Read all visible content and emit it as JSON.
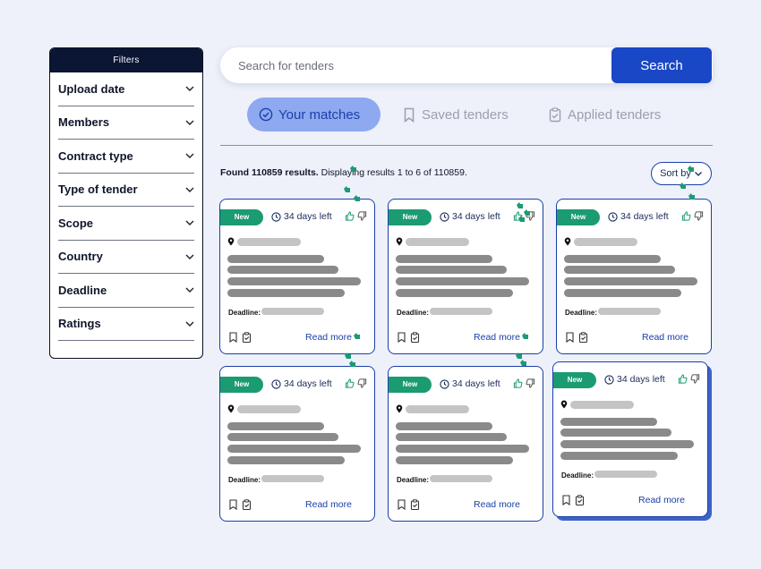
{
  "sidebar": {
    "title": "Filters",
    "items": [
      {
        "label": "Upload date"
      },
      {
        "label": "Members"
      },
      {
        "label": "Contract type"
      },
      {
        "label": "Type of tender"
      },
      {
        "label": "Scope"
      },
      {
        "label": "Country"
      },
      {
        "label": "Deadline"
      },
      {
        "label": "Ratings"
      }
    ]
  },
  "search": {
    "placeholder": "Search for tenders",
    "value": "",
    "button_label": "Search"
  },
  "tabs": [
    {
      "label": "Your matches",
      "active": true,
      "icon": "check-badge-icon"
    },
    {
      "label": "Saved tenders",
      "active": false,
      "icon": "bookmark-icon"
    },
    {
      "label": "Applied tenders",
      "active": false,
      "icon": "clipboard-check-icon"
    }
  ],
  "results": {
    "found_text": "Found 110859 results.",
    "display_text": " Displaying results 1 to 6 of 110859."
  },
  "sort": {
    "label": "Sort by"
  },
  "cards": [
    {
      "badge": "New",
      "days": "34 days left",
      "deadline_label": "Deadline:",
      "read_more": "Read more"
    },
    {
      "badge": "New",
      "days": "34 days left",
      "deadline_label": "Deadline:",
      "read_more": "Read more"
    },
    {
      "badge": "New",
      "days": "34 days left",
      "deadline_label": "Deadline:",
      "read_more": "Read more"
    },
    {
      "badge": "New",
      "days": "34 days left",
      "deadline_label": "Deadline:",
      "read_more": "Read more"
    },
    {
      "badge": "New",
      "days": "34 days left",
      "deadline_label": "Deadline:",
      "read_more": "Read more"
    },
    {
      "badge": "New",
      "days": "34 days left",
      "deadline_label": "Deadline:",
      "read_more": "Read more"
    }
  ],
  "colors": {
    "primary": "#1947c6",
    "badge_green": "#1b9b72",
    "active_tab_bg": "#8ea9f0",
    "sidebar_header": "#0a1633",
    "page_bg": "#eef1f9"
  }
}
